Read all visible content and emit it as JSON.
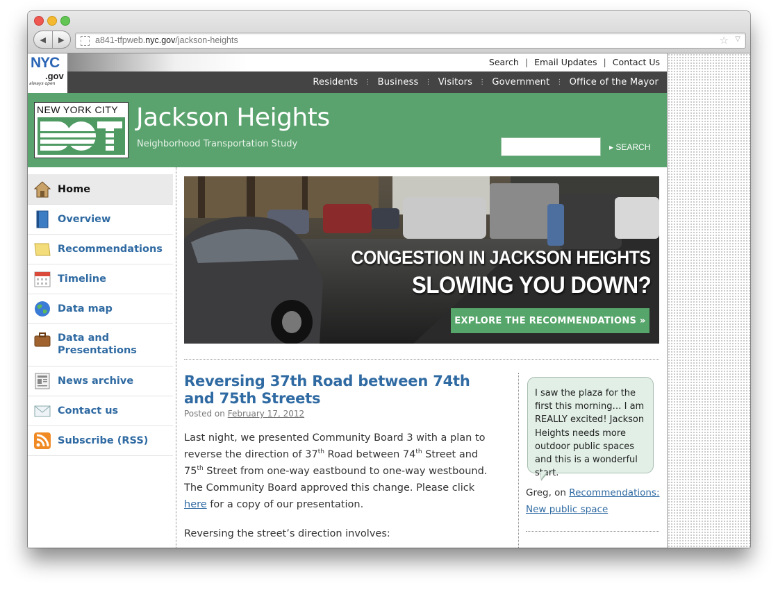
{
  "browser": {
    "url_prefix": "a841-tfpweb.",
    "url_domain": "nyc.gov",
    "url_path": "/jackson-heights"
  },
  "nyc": {
    "logo_nyc": "NYC",
    "logo_gov": ".gov",
    "tagline": "always open"
  },
  "utility_nav": [
    "Search",
    "Email Updates",
    "Contact Us"
  ],
  "main_nav": [
    "Residents",
    "Business",
    "Visitors",
    "Government",
    "Office of the Mayor"
  ],
  "banner": {
    "dot_logo_text": "NEW YORK CITY",
    "title": "Jackson Heights",
    "subtitle": "Neighborhood Transportation Study",
    "search_button": "SEARCH",
    "search_placeholder": ""
  },
  "sidebar_nav": [
    {
      "label": "Home",
      "icon": "house-icon",
      "active": true
    },
    {
      "label": "Overview",
      "icon": "book-icon"
    },
    {
      "label": "Recommendations",
      "icon": "note-icon"
    },
    {
      "label": "Timeline",
      "icon": "calendar-icon"
    },
    {
      "label": "Data map",
      "icon": "globe-icon"
    },
    {
      "label": "Data and Presentations",
      "icon": "briefcase-icon"
    },
    {
      "label": "News archive",
      "icon": "newspaper-icon"
    },
    {
      "label": "Contact us",
      "icon": "envelope-icon"
    },
    {
      "label": "Subscribe (RSS)",
      "icon": "rss-icon"
    }
  ],
  "hero": {
    "line1": "CONGESTION IN JACKSON HEIGHTS",
    "line2": "SLOWING YOU DOWN?",
    "cta": "EXPLORE THE RECOMMENDATIONS »"
  },
  "post": {
    "title": "Reversing 37th Road between 74th and 75th Streets",
    "posted_on": "Posted on",
    "date": "February 17, 2012",
    "p1_a": "Last night, we presented Community Board 3 with a plan to reverse the direction of 37",
    "p1_sup1": "th",
    "p1_b": " Road between 74",
    "p1_sup2": "th",
    "p1_c": " Street and 75",
    "p1_sup3": "th",
    "p1_d": " Street from one-way eastbound to one-way westbound. The Community Board approved this change. Please click ",
    "p1_link": "here",
    "p1_e": " for a copy of our presentation.",
    "p2": "Reversing the street’s direction involves:"
  },
  "quote": {
    "text": "I saw the plaza for the first this morning… I am REALLY excited! Jackson Heights needs more outdoor public spaces and this is a wonderful start.",
    "author": "Greg, on",
    "link": "Recommendations: New public space"
  },
  "colors": {
    "banner_green": "#5aa36e",
    "link_blue": "#2f6aa2",
    "nav_dark": "#444444"
  }
}
